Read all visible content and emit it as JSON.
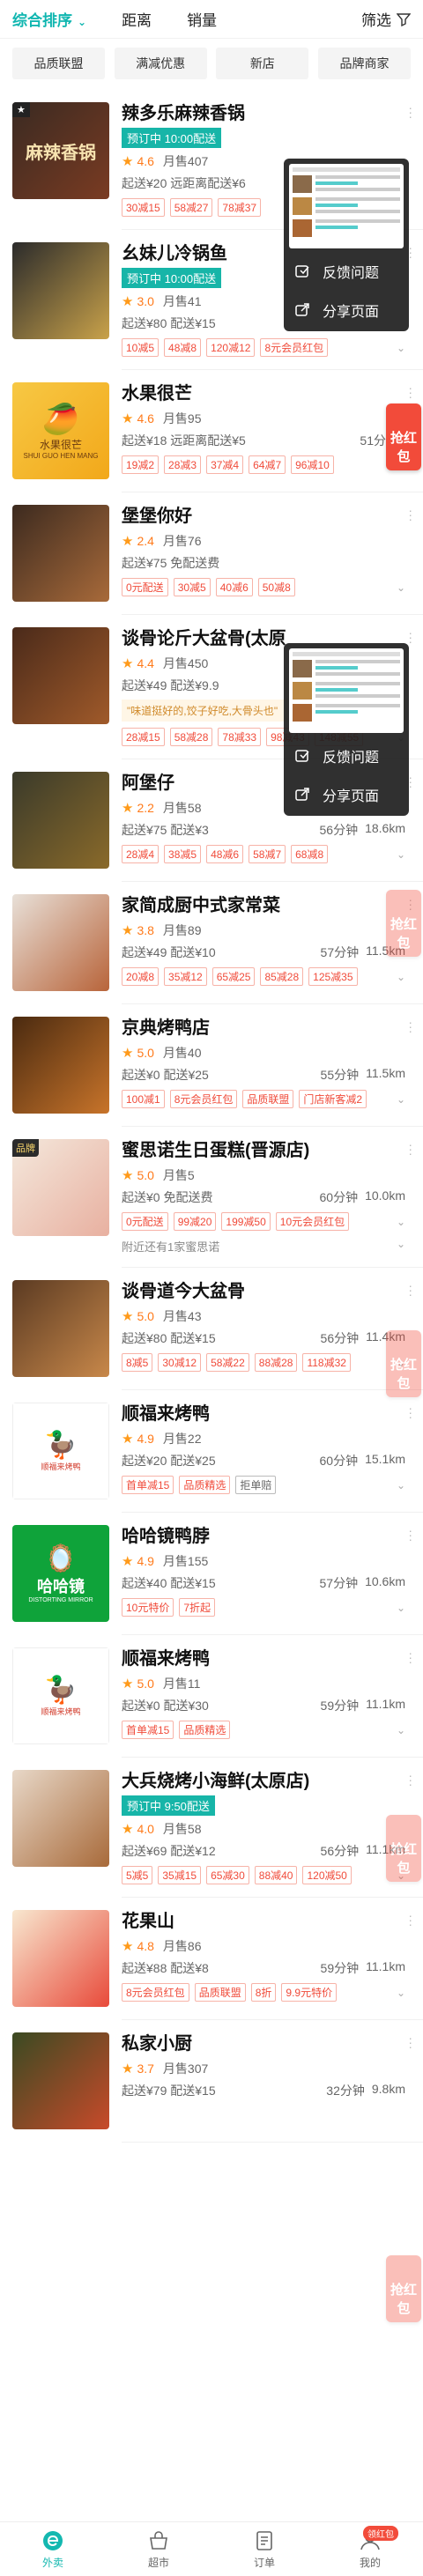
{
  "sortbar": {
    "default_sort": "综合排序",
    "distance": "距离",
    "sales": "销量",
    "filter": "筛选"
  },
  "chips": [
    "品质联盟",
    "满减优惠",
    "新店",
    "品牌商家"
  ],
  "popup": {
    "feedback": "反馈问题",
    "share": "分享页面"
  },
  "red_packet": "抢红包",
  "shops": [
    {
      "name": "辣多乐麻辣香锅",
      "thumb_text": "麻辣香锅",
      "presale": "预订中 10:00配送",
      "rating": "4.6",
      "monthly": "月售407",
      "delivery": "起送¥20  远距离配送¥6",
      "time": "",
      "distance": "",
      "promos": [
        "30减15",
        "58减27",
        "78减37"
      ]
    },
    {
      "name": "幺妹儿冷锅鱼",
      "presale": "预订中 10:00配送",
      "rating": "3.0",
      "monthly": "月售41",
      "delivery": "起送¥80  配送¥15",
      "time": "",
      "distance": "",
      "promos": [
        "10减5",
        "48减8",
        "120减12",
        "8元会员红包"
      ]
    },
    {
      "name": "水果很芒",
      "thumb_text": "水果很芒",
      "thumb_sub": "SHUI GUO HEN MANG",
      "presale": "",
      "rating": "4.6",
      "monthly": "月售95",
      "delivery": "起送¥18  远距离配送¥5",
      "time": "51分钟",
      "distance": "",
      "promos": [
        "19减2",
        "28减3",
        "37减4",
        "64减7",
        "96减10"
      ]
    },
    {
      "name": "堡堡你好",
      "presale": "",
      "rating": "2.4",
      "monthly": "月售76",
      "delivery": "起送¥75  免配送费",
      "time": "",
      "distance": "",
      "promos": [
        "0元配送",
        "30减5",
        "40减6",
        "50减8"
      ]
    },
    {
      "name": "谈骨论斤大盆骨(太原",
      "presale": "",
      "rating": "4.4",
      "monthly": "月售450",
      "delivery": "起送¥49  配送¥9.9",
      "time": "",
      "distance": "",
      "review": "\"味道挺好的,饺子好吃,大骨头也\"",
      "promos": [
        "28减15",
        "58减28",
        "78减33",
        "98减43",
        "148减55"
      ]
    },
    {
      "name": "阿堡仔",
      "presale": "",
      "rating": "2.2",
      "monthly": "月售58",
      "delivery": "起送¥75  配送¥3",
      "time": "56分钟",
      "distance": "18.6km",
      "promos": [
        "28减4",
        "38减5",
        "48减6",
        "58减7",
        "68减8"
      ]
    },
    {
      "name": "家简成厨中式家常菜",
      "presale": "",
      "rating": "3.8",
      "monthly": "月售89",
      "delivery": "起送¥49  配送¥10",
      "time": "57分钟",
      "distance": "11.5km",
      "promos": [
        "20减8",
        "35减12",
        "65减25",
        "85减28",
        "125减35"
      ]
    },
    {
      "name": "京典烤鸭店",
      "presale": "",
      "rating": "5.0",
      "monthly": "月售40",
      "delivery": "起送¥0  配送¥25",
      "time": "55分钟",
      "distance": "11.5km",
      "promos": [
        "100减1",
        "8元会员红包",
        "品质联盟",
        "门店新客减2"
      ]
    },
    {
      "name": "蜜思诺生日蛋糕(晋源店)",
      "brand": "品牌",
      "presale": "",
      "rating": "5.0",
      "monthly": "月售5",
      "delivery": "起送¥0  免配送费",
      "time": "60分钟",
      "distance": "10.0km",
      "promos": [
        "0元配送",
        "99减20",
        "199减50",
        "10元会员红包"
      ],
      "nearby": "附近还有1家蜜思诺"
    },
    {
      "name": "谈骨道今大盆骨",
      "presale": "",
      "rating": "5.0",
      "monthly": "月售43",
      "delivery": "起送¥80  配送¥15",
      "time": "56分钟",
      "distance": "11.4km",
      "promos": [
        "8减5",
        "30减12",
        "58减22",
        "88减28",
        "118减32"
      ]
    },
    {
      "name": "顺福来烤鸭",
      "thumb_text": "顺福来烤鸭",
      "presale": "",
      "rating": "4.9",
      "monthly": "月售22",
      "delivery": "起送¥20  配送¥25",
      "time": "60分钟",
      "distance": "15.1km",
      "promos": [
        "首单减15",
        "品质精选",
        "拒单赔"
      ]
    },
    {
      "name": "哈哈镜鸭脖",
      "thumb_text": "哈哈镜",
      "thumb_sub": "DISTORTING MIRROR",
      "presale": "",
      "rating": "4.9",
      "monthly": "月售155",
      "delivery": "起送¥40  配送¥15",
      "time": "57分钟",
      "distance": "10.6km",
      "promos": [
        "10元特价",
        "7折起"
      ]
    },
    {
      "name": "顺福来烤鸭",
      "thumb_text": "顺福来烤鸭",
      "presale": "",
      "rating": "5.0",
      "monthly": "月售11",
      "delivery": "起送¥0  配送¥30",
      "time": "59分钟",
      "distance": "11.1km",
      "promos": [
        "首单减15",
        "品质精选"
      ]
    },
    {
      "name": "大兵烧烤小海鲜(太原店)",
      "presale": "预订中 9:50配送",
      "rating": "4.0",
      "monthly": "月售58",
      "delivery": "起送¥69  配送¥12",
      "time": "56分钟",
      "distance": "11.1km",
      "promos": [
        "5减5",
        "35减15",
        "65减30",
        "88减40",
        "120减50"
      ]
    },
    {
      "name": "花果山",
      "presale": "",
      "rating": "4.8",
      "monthly": "月售86",
      "delivery": "起送¥88  配送¥8",
      "time": "59分钟",
      "distance": "11.1km",
      "promos": [
        "8元会员红包",
        "品质联盟",
        "8折",
        "9.9元特价"
      ]
    },
    {
      "name": "私家小厨",
      "presale": "",
      "rating": "3.7",
      "monthly": "月售307",
      "delivery": "起送¥79  配送¥15",
      "time": "32分钟",
      "distance": "9.8km",
      "promos": []
    }
  ],
  "tabbar": {
    "tabs": [
      "外卖",
      "超市",
      "订单",
      "我的"
    ],
    "badge": "领红包"
  }
}
